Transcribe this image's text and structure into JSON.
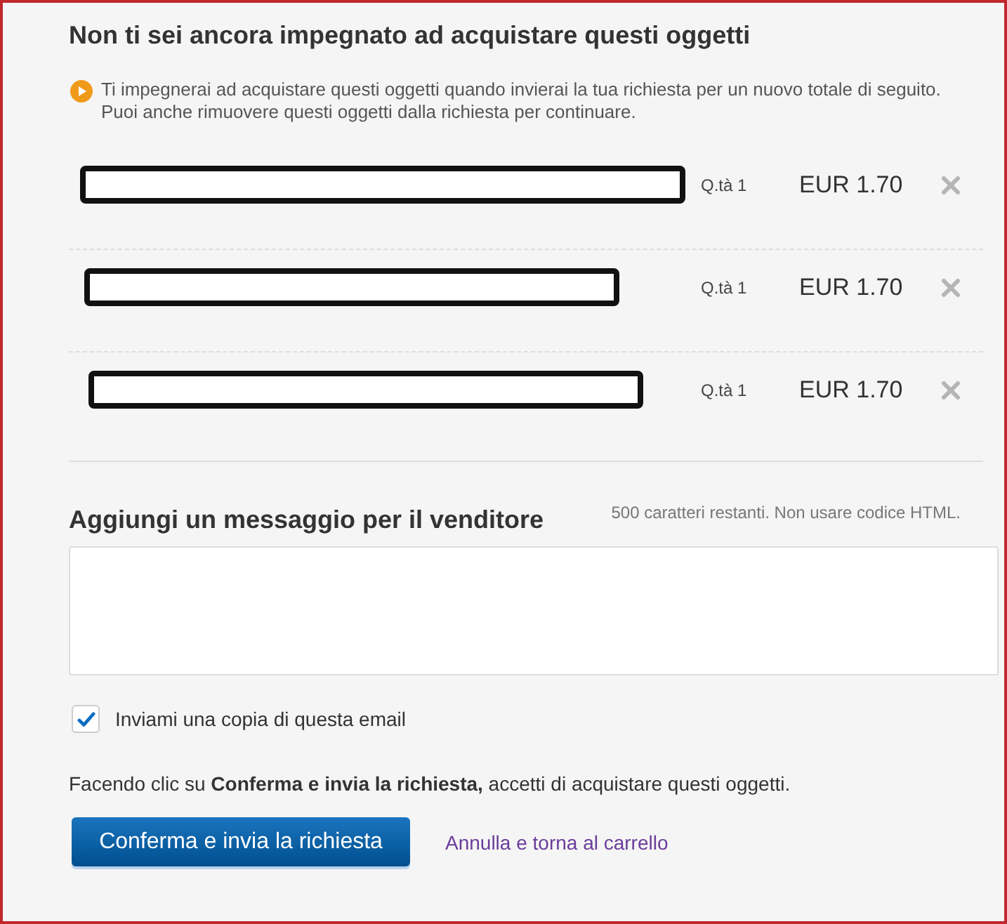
{
  "heading": "Non ti sei ancora impegnato ad acquistare questi oggetti",
  "notice": {
    "lines": [
      "Ti impegnerai ad acquistare questi oggetti quando invierai la tua richiesta per un nuovo totale di seguito.",
      "Puoi anche rimuovere questi oggetti dalla richiesta per continuare."
    ]
  },
  "items": [
    {
      "quantity": "Q.tà 1",
      "price": "EUR 1.70"
    },
    {
      "quantity": "Q.tà 1",
      "price": "EUR 1.70"
    },
    {
      "quantity": "Q.tà 1",
      "price": "EUR 1.70"
    }
  ],
  "message": {
    "heading": "Aggiungi un messaggio per il venditore",
    "note": "500 caratteri restanti. Non usare codice HTML."
  },
  "copy_checkbox": {
    "label": "Inviami una copia di questa email",
    "checked": true
  },
  "consent": "Facendo clic su **Conferma e invia la richiesta,** accetti di acquistare questi oggetti.",
  "actions": {
    "submit": "Conferma e invia la richiesta",
    "cancel_link": "Annulla e torna al carrello"
  }
}
